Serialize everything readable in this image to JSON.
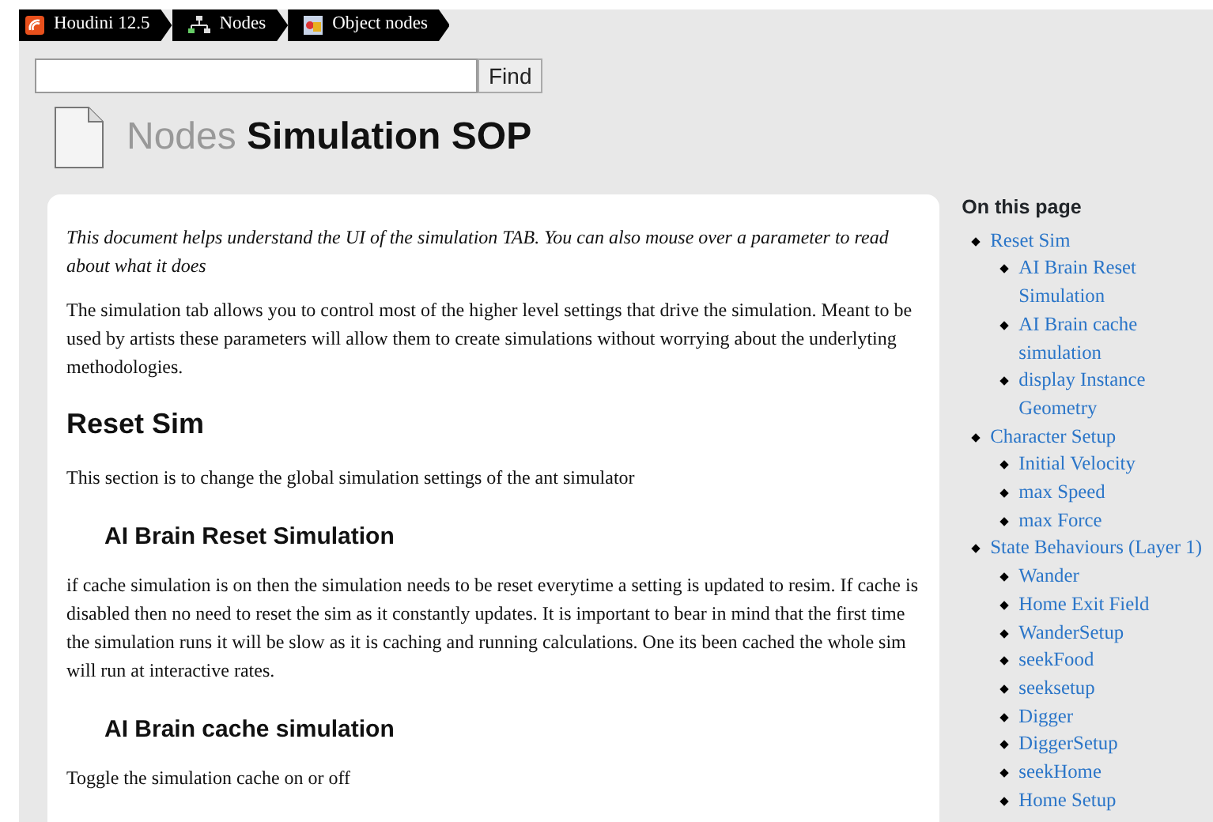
{
  "breadcrumbs": [
    {
      "label": "Houdini 12.5"
    },
    {
      "label": "Nodes"
    },
    {
      "label": "Object nodes"
    }
  ],
  "search": {
    "button": "Find"
  },
  "title": {
    "prefix": "Nodes",
    "name": "Simulation SOP"
  },
  "intro": "This document helps understand the UI of the simulation TAB. You can also mouse over a parameter to read about what it does",
  "paragraph": "The simulation tab allows you to control most of the higher level settings that drive the simulation. Meant to be used by artists these parameters will allow them to create simulations without worrying about the underlyting methodologies.",
  "sections": [
    {
      "heading": "Reset Sim",
      "text": "This section is to change the global simulation settings of the ant simulator",
      "subsections": [
        {
          "heading": "AI Brain Reset Simulation",
          "text": "if cache simulation is on then the simulation needs to be reset everytime a setting is updated to resim. If cache is disabled then no need to reset the sim as it constantly updates. It is important to bear in mind that the first time the simulation runs it will be slow as it is caching and running calculations. One its been cached the whole sim will run at interactive rates."
        },
        {
          "heading": "AI Brain cache simulation",
          "text": "Toggle the simulation cache on or off"
        }
      ]
    }
  ],
  "toc": {
    "title": "On this page",
    "items": [
      {
        "label": "Reset Sim",
        "children": [
          {
            "label": "AI Brain Reset Simulation"
          },
          {
            "label": "AI Brain cache simulation"
          },
          {
            "label": "display Instance Geometry"
          }
        ]
      },
      {
        "label": "Character Setup",
        "children": [
          {
            "label": "Initial Velocity"
          },
          {
            "label": "max Speed"
          },
          {
            "label": "max Force"
          }
        ]
      },
      {
        "label": "State Behaviours (Layer 1)",
        "children": [
          {
            "label": "Wander"
          },
          {
            "label": "Home Exit Field"
          },
          {
            "label": "WanderSetup"
          },
          {
            "label": "seekFood"
          },
          {
            "label": "seeksetup"
          },
          {
            "label": "Digger"
          },
          {
            "label": "DiggerSetup"
          },
          {
            "label": "seekHome"
          },
          {
            "label": "Home Setup"
          }
        ]
      }
    ]
  }
}
